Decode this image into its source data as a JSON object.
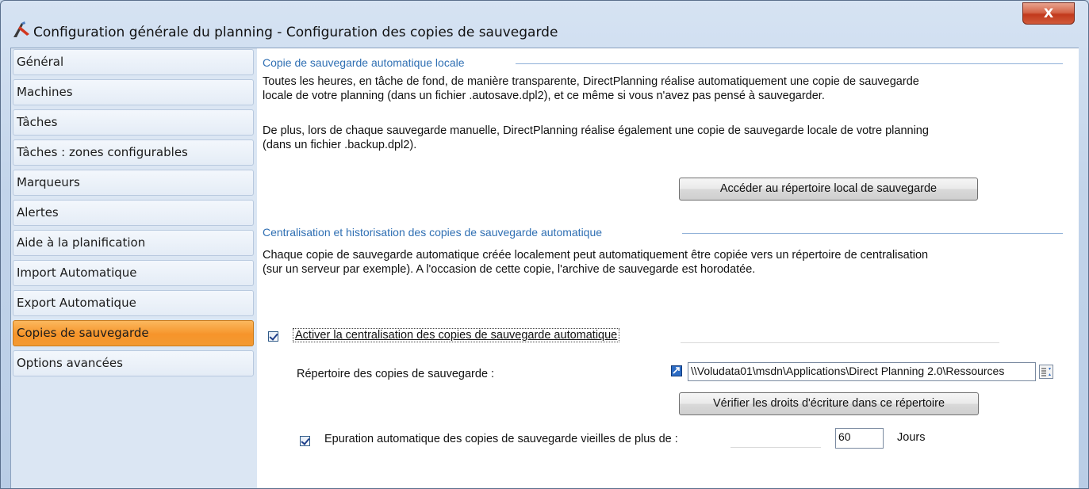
{
  "window": {
    "title": "Configuration générale du planning - Configuration des copies de sauvegarde",
    "close_label": "X"
  },
  "sidebar": {
    "items": [
      {
        "label": "Général"
      },
      {
        "label": "Machines"
      },
      {
        "label": "Tâches"
      },
      {
        "label": "Tâches : zones configurables"
      },
      {
        "label": "Marqueurs"
      },
      {
        "label": "Alertes"
      },
      {
        "label": "Aide à la planification"
      },
      {
        "label": "Import Automatique"
      },
      {
        "label": "Export Automatique"
      },
      {
        "label": "Copies de sauvegarde"
      },
      {
        "label": "Options avancées"
      }
    ],
    "active": "Copies de sauvegarde"
  },
  "local_backup": {
    "heading": "Copie de sauvegarde automatique locale",
    "para1_line1": "Toutes les heures, en tâche de fond, de manière transparente, DirectPlanning réalise automatiquement une copie de sauvegarde",
    "para1_line2": "locale de votre planning (dans un fichier .autosave.dpl2), et ce même si vous n'avez pas pensé à sauvegarder.",
    "para2_line1": "De plus, lors de chaque sauvegarde manuelle, DirectPlanning réalise également une copie de sauvegarde locale de votre planning",
    "para2_line2": "(dans un fichier .backup.dpl2).",
    "open_folder_button": "Accéder au répertoire local de sauvegarde"
  },
  "central_backup": {
    "heading": "Centralisation et historisation des copies de sauvegarde automatique",
    "para_line1": "Chaque copie de sauvegarde automatique créée localement peut automatiquement être copiée vers un répertoire de centralisation",
    "para_line2": "(sur un serveur par exemple). A l'occasion de cette copie, l'archive de sauvegarde est horodatée.",
    "enable_checkbox_label": "Activer la centralisation des copies de sauvegarde automatique",
    "enable_checked": true,
    "folder_label": "Répertoire des copies de sauvegarde :",
    "folder_value": "\\\\Voludata01\\msdn\\Applications\\Direct Planning 2.0\\Ressources",
    "verify_button": "Vérifier les droits d'écriture dans ce répertoire",
    "purge_checkbox_label": "Epuration automatique des copies de sauvegarde vieilles de plus de :",
    "purge_checked": true,
    "purge_days_value": "60",
    "purge_days_unit": "Jours"
  },
  "colors": {
    "active_item": "#f6942a",
    "section_heading": "#2f6fb3",
    "close_button": "#c1391c"
  }
}
